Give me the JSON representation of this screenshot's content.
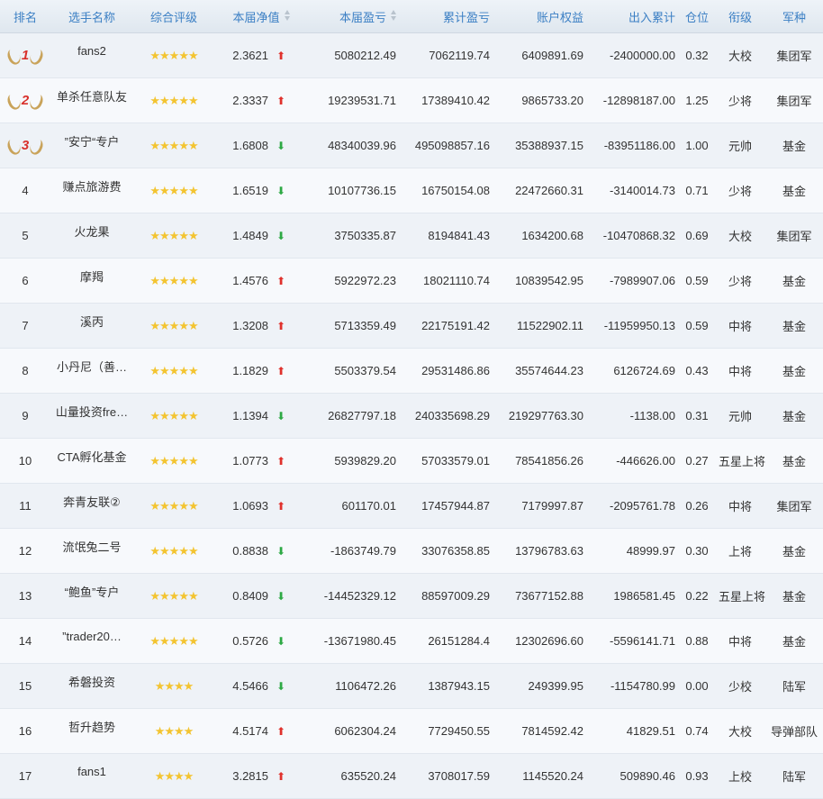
{
  "headers": {
    "rank": "排名",
    "name": "选手名称",
    "rating": "综合评级",
    "nav": "本届净值",
    "current_pnl": "本届盈亏",
    "cumulative_pnl": "累计盈亏",
    "equity": "账户权益",
    "inout": "出入累计",
    "position": "仓位",
    "level": "衔级",
    "army": "军种"
  },
  "colors": {
    "up": "#e0312c",
    "down": "#2da944",
    "star": "#f3c431",
    "header": "#3b7fc4"
  },
  "rows": [
    {
      "rank": "1",
      "medal": true,
      "name": "fans2",
      "stars": 5,
      "nav": "2.3621",
      "trend": "up",
      "cur": "5080212.49",
      "cum": "7062119.74",
      "eq": "6409891.69",
      "io": "-2400000.00",
      "pos": "0.32",
      "lvl": "大校",
      "arm": "集团军"
    },
    {
      "rank": "2",
      "medal": true,
      "name": "单杀任意队友",
      "stars": 5,
      "nav": "2.3337",
      "trend": "up",
      "cur": "19239531.71",
      "cum": "17389410.42",
      "eq": "9865733.20",
      "io": "-12898187.00",
      "pos": "1.25",
      "lvl": "少将",
      "arm": "集团军"
    },
    {
      "rank": "3",
      "medal": true,
      "name": "”安宁“专户",
      "stars": 5,
      "nav": "1.6808",
      "trend": "down",
      "cur": "48340039.96",
      "cum": "495098857.16",
      "eq": "35388937.15",
      "io": "-83951186.00",
      "pos": "1.00",
      "lvl": "元帅",
      "arm": "基金"
    },
    {
      "rank": "4",
      "medal": false,
      "name": "赚点旅游费",
      "stars": 5,
      "nav": "1.6519",
      "trend": "down",
      "cur": "10107736.15",
      "cum": "16750154.08",
      "eq": "22472660.31",
      "io": "-3140014.73",
      "pos": "0.71",
      "lvl": "少将",
      "arm": "基金"
    },
    {
      "rank": "5",
      "medal": false,
      "name": "火龙果",
      "stars": 5,
      "nav": "1.4849",
      "trend": "down",
      "cur": "3750335.87",
      "cum": "8194841.43",
      "eq": "1634200.68",
      "io": "-10470868.32",
      "pos": "0.69",
      "lvl": "大校",
      "arm": "集团军"
    },
    {
      "rank": "6",
      "medal": false,
      "name": "摩羯",
      "stars": 5,
      "nav": "1.4576",
      "trend": "up",
      "cur": "5922972.23",
      "cum": "18021110.74",
      "eq": "10839542.95",
      "io": "-7989907.06",
      "pos": "0.59",
      "lvl": "少将",
      "arm": "基金"
    },
    {
      "rank": "7",
      "medal": false,
      "name": "溪丙",
      "stars": 5,
      "nav": "1.3208",
      "trend": "up",
      "cur": "5713359.49",
      "cum": "22175191.42",
      "eq": "11522902.11",
      "io": "-11959950.13",
      "pos": "0.59",
      "lvl": "中将",
      "arm": "基金"
    },
    {
      "rank": "8",
      "medal": false,
      "name": "小丹尼（善…",
      "stars": 5,
      "nav": "1.1829",
      "trend": "up",
      "cur": "5503379.54",
      "cum": "29531486.86",
      "eq": "35574644.23",
      "io": "6126724.69",
      "pos": "0.43",
      "lvl": "中将",
      "arm": "基金"
    },
    {
      "rank": "9",
      "medal": false,
      "name": "山量投资fre…",
      "stars": 5,
      "nav": "1.1394",
      "trend": "down",
      "cur": "26827797.18",
      "cum": "240335698.29",
      "eq": "219297763.30",
      "io": "-1138.00",
      "pos": "0.31",
      "lvl": "元帅",
      "arm": "基金"
    },
    {
      "rank": "10",
      "medal": false,
      "name": "CTA孵化基金",
      "stars": 5,
      "nav": "1.0773",
      "trend": "up",
      "cur": "5939829.20",
      "cum": "57033579.01",
      "eq": "78541856.26",
      "io": "-446626.00",
      "pos": "0.27",
      "lvl": "五星上将",
      "arm": "基金"
    },
    {
      "rank": "11",
      "medal": false,
      "name": "奔青友联②",
      "stars": 5,
      "nav": "1.0693",
      "trend": "up",
      "cur": "601170.01",
      "cum": "17457944.87",
      "eq": "7179997.87",
      "io": "-2095761.78",
      "pos": "0.26",
      "lvl": "中将",
      "arm": "集团军"
    },
    {
      "rank": "12",
      "medal": false,
      "name": "流氓兔二号",
      "stars": 5,
      "nav": "0.8838",
      "trend": "down",
      "cur": "-1863749.79",
      "cum": "33076358.85",
      "eq": "13796783.63",
      "io": "48999.97",
      "pos": "0.30",
      "lvl": "上将",
      "arm": "基金"
    },
    {
      "rank": "13",
      "medal": false,
      "name": "“鲍鱼”专户",
      "stars": 5,
      "nav": "0.8409",
      "trend": "down",
      "cur": "-14452329.12",
      "cum": "88597009.29",
      "eq": "73677152.88",
      "io": "1986581.45",
      "pos": "0.22",
      "lvl": "五星上将",
      "arm": "基金"
    },
    {
      "rank": "14",
      "medal": false,
      "name": "”trader20…",
      "stars": 5,
      "nav": "0.5726",
      "trend": "down",
      "cur": "-13671980.45",
      "cum": "26151284.4",
      "eq": "12302696.60",
      "io": "-5596141.71",
      "pos": "0.88",
      "lvl": "中将",
      "arm": "基金"
    },
    {
      "rank": "15",
      "medal": false,
      "name": "希磐投资",
      "stars": 4,
      "nav": "4.5466",
      "trend": "down",
      "cur": "1106472.26",
      "cum": "1387943.15",
      "eq": "249399.95",
      "io": "-1154780.99",
      "pos": "0.00",
      "lvl": "少校",
      "arm": "陆军"
    },
    {
      "rank": "16",
      "medal": false,
      "name": "哲升趋势",
      "stars": 4,
      "nav": "4.5174",
      "trend": "up",
      "cur": "6062304.24",
      "cum": "7729450.55",
      "eq": "7814592.42",
      "io": "41829.51",
      "pos": "0.74",
      "lvl": "大校",
      "arm": "导弹部队"
    },
    {
      "rank": "17",
      "medal": false,
      "name": "fans1",
      "stars": 4,
      "nav": "3.2815",
      "trend": "up",
      "cur": "635520.24",
      "cum": "3708017.59",
      "eq": "1145520.24",
      "io": "509890.46",
      "pos": "0.93",
      "lvl": "上校",
      "arm": "陆军"
    }
  ]
}
